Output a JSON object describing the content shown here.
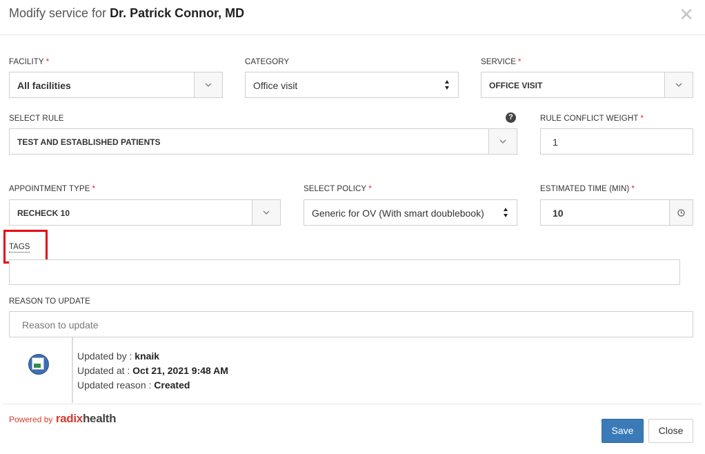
{
  "header": {
    "title_prefix": "Modify service for",
    "provider_name": "Dr. Patrick Connor, MD",
    "close_symbol": "✕"
  },
  "form": {
    "facility": {
      "label": "FACILITY",
      "required": "*",
      "value": "All facilities"
    },
    "category": {
      "label": "CATEGORY",
      "value": "Office visit"
    },
    "service": {
      "label": "SERVICE",
      "required": "*",
      "value": "OFFICE VISIT"
    },
    "select_rule": {
      "label": "SELECT RULE",
      "value": "TEST AND ESTABLISHED PATIENTS",
      "help_icon": "question-circle-icon",
      "help_symbol": "?"
    },
    "rule_conflict_weight": {
      "label": "RULE CONFLICT WEIGHT",
      "required": "*",
      "value": "1"
    },
    "appointment_type": {
      "label": "APPOINTMENT TYPE",
      "required": "*",
      "value": "RECHECK 10"
    },
    "select_policy": {
      "label": "SELECT POLICY",
      "required": "*",
      "value": "Generic for OV (With smart doublebook)"
    },
    "estimated_time": {
      "label": "ESTIMATED TIME (MIN)",
      "required": "*",
      "value": "10",
      "icon": "clock-icon"
    },
    "tags": {
      "label": "TAGS",
      "value": ""
    },
    "reason_to_update": {
      "label": "REASON TO UPDATE",
      "placeholder": "Reason to update"
    }
  },
  "audit": {
    "updated_by_label": "Updated by :",
    "updated_by": "knaik",
    "updated_at_label": "Updated at :",
    "updated_at": "Oct 21, 2021 9:48 AM",
    "updated_reason_label": "Updated reason :",
    "updated_reason": "Created"
  },
  "footer": {
    "powered_by": "Powered by",
    "brand_part1": "radix",
    "brand_part2": "health",
    "save_label": "Save",
    "close_label": "Close"
  },
  "colors": {
    "required": "#e0242c",
    "save_button": "#3a7ab8",
    "highlight_box": "#e30613",
    "brand_red": "#d63a2f"
  }
}
